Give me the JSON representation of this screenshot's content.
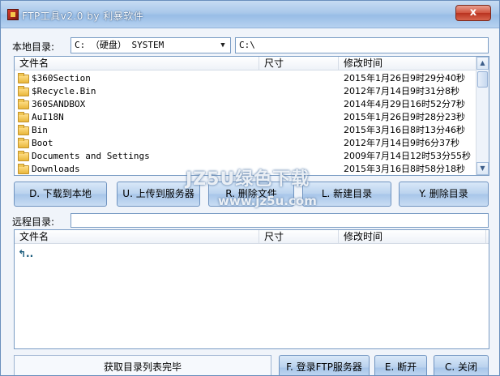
{
  "window": {
    "title": "FTP工具v2.0  by 利暴软件",
    "close_symbol": "x"
  },
  "local": {
    "label": "本地目录:",
    "drive_combo": "C: （硬盘） SYSTEM",
    "path": "C:\\",
    "columns": [
      "文件名",
      "尺寸",
      "修改时间"
    ],
    "rows": [
      {
        "name": "$360Section",
        "time": "2015年1月26日9时29分40秒"
      },
      {
        "name": "$Recycle.Bin",
        "time": "2012年7月14日9时31分8秒"
      },
      {
        "name": "360SANDBOX",
        "time": "2014年4月29日16时52分7秒"
      },
      {
        "name": "AuI18N",
        "time": "2015年1月26日9时28分23秒"
      },
      {
        "name": "Bin",
        "time": "2015年3月16日8时13分46秒"
      },
      {
        "name": "Boot",
        "time": "2012年7月14日9时6分37秒"
      },
      {
        "name": "Documents and Settings",
        "time": "2009年7月14日12时53分55秒"
      },
      {
        "name": "Downloads",
        "time": "2015年3月16日8时58分18秒"
      }
    ]
  },
  "buttons": {
    "download": "D. 下载到本地",
    "upload": "U. 上传到服务器",
    "delete_file": "R. 删除文件",
    "new_dir": "L. 新建目录",
    "delete_dir": "Y. 删除目录",
    "login": "F. 登录FTP服务器",
    "disconnect": "E. 断开",
    "close": "C. 关闭"
  },
  "remote": {
    "label": "远程目录:",
    "path": "",
    "columns": [
      "文件名",
      "尺寸",
      "修改时间"
    ],
    "up_entry": "↰.."
  },
  "status": {
    "text": "获取目录列表完毕"
  },
  "watermark": {
    "main": "JZ5U绿色下载",
    "sub": "www.jz5u.com"
  }
}
